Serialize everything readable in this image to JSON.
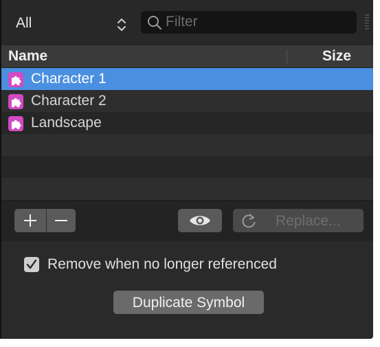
{
  "top": {
    "dropdown_value": "All",
    "filter_placeholder": "Filter",
    "filter_value": ""
  },
  "table": {
    "col_name": "Name",
    "col_size": "Size",
    "rows": [
      {
        "label": "Character 1",
        "icon": "symbol-icon",
        "selected": true
      },
      {
        "label": "Character 2",
        "icon": "symbol-icon",
        "selected": false
      },
      {
        "label": "Landscape",
        "icon": "symbol-icon",
        "selected": false
      }
    ]
  },
  "toolbar": {
    "add_icon": "plus-icon",
    "remove_icon": "minus-icon",
    "preview_icon": "eye-icon",
    "refresh_icon": "refresh-icon",
    "replace_label": "Replace..."
  },
  "options": {
    "remove_unreferenced_label": "Remove when no longer referenced",
    "remove_unreferenced_checked": true,
    "duplicate_label": "Duplicate Symbol"
  },
  "colors": {
    "panel_bg": "#262626",
    "selection": "#4a8fe0",
    "symbol_icon": "#d24ac3",
    "button": "#5a5a5a"
  }
}
